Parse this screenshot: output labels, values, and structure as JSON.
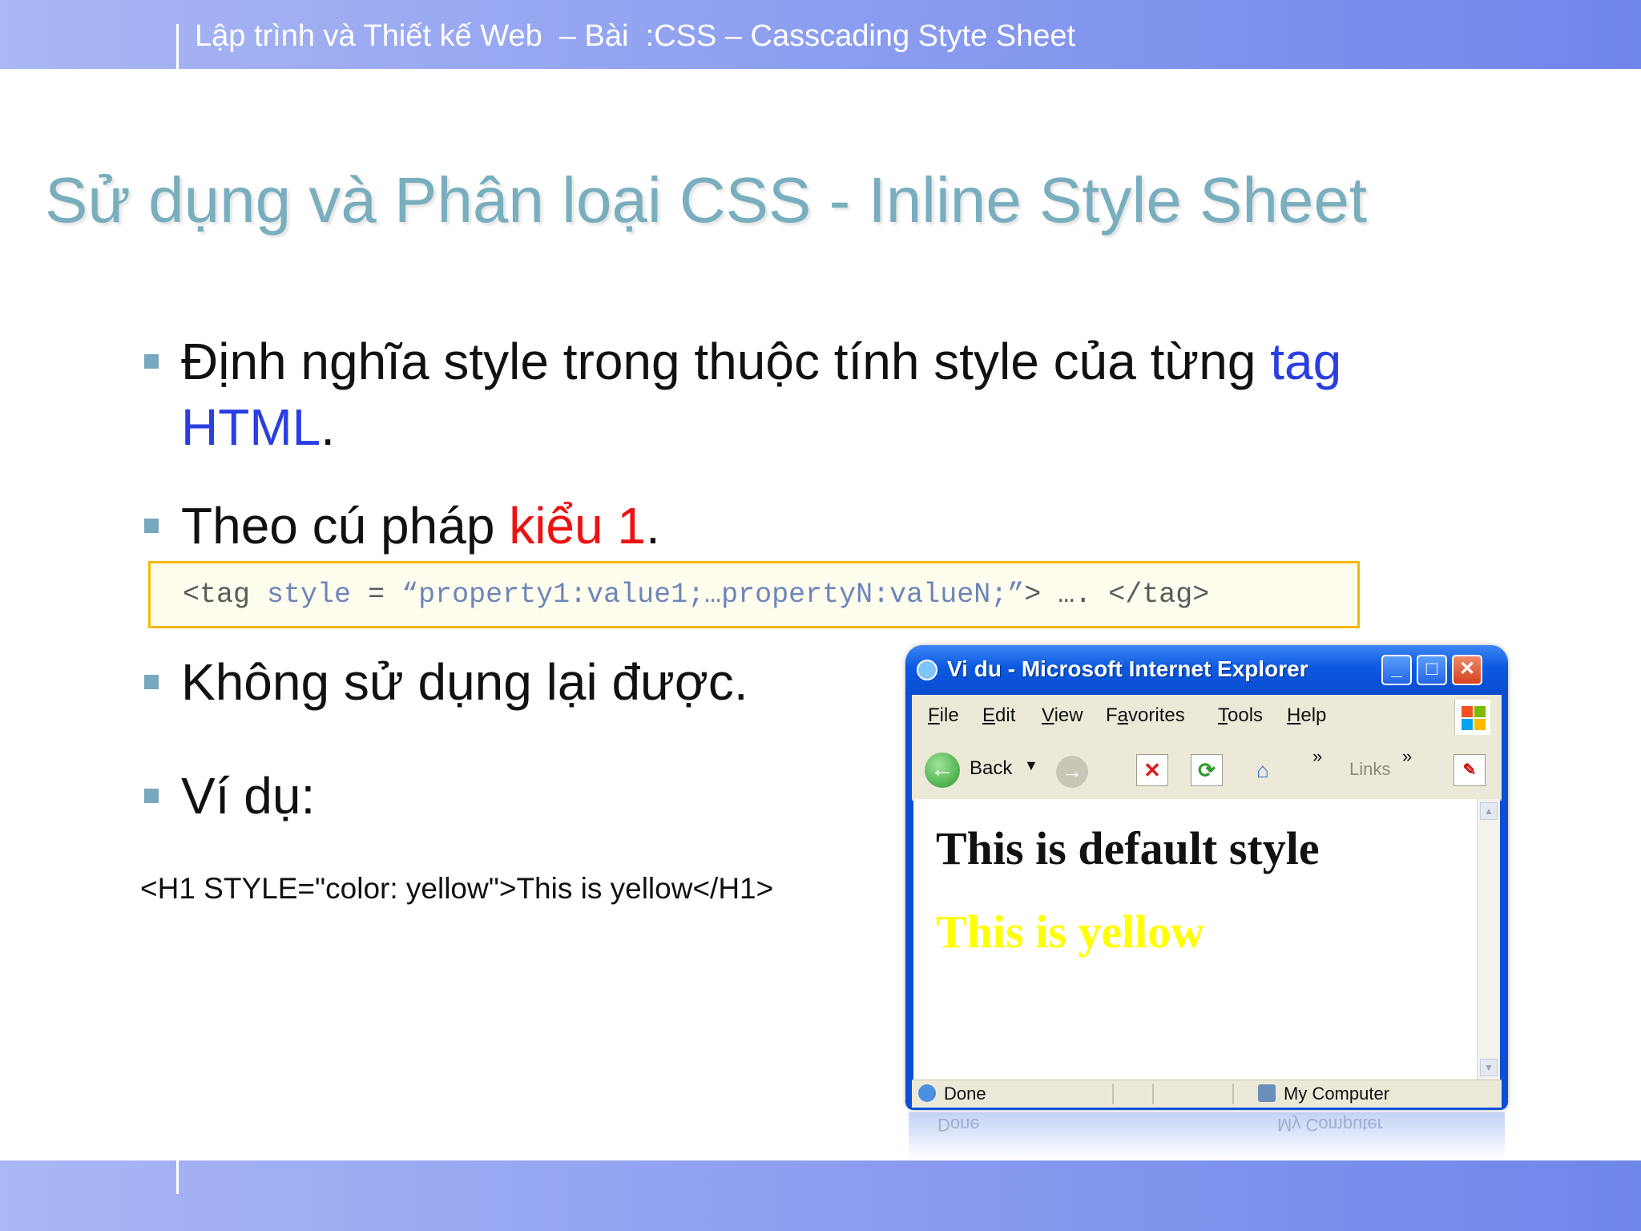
{
  "header": {
    "text": "Lập trình và Thiết kế Web  – Bài  :CSS – Casscading Styte Sheet"
  },
  "slide": {
    "title": "Sử dụng và Phân loại CSS - Inline Style Sheet",
    "bullets": {
      "b1_text": "Định nghĩa style trong thuộc tính style của từng ",
      "b1_tag": "tag",
      "b1_html": "HTML",
      "b1_period": ".",
      "b2_text": "Theo cú pháp ",
      "b2_red": "kiểu 1",
      "b2_period": ".",
      "b3_text": "Không sử dụng lại được.",
      "b4_text": "Ví dụ:"
    },
    "code_syntax": {
      "part1": "<tag ",
      "part2": "style",
      "part3": " = ",
      "part4": "“property1:value1;…propertyN:valueN;”",
      "part5": "> …. </tag>"
    },
    "example_code": "<H1 STYLE=\"color: yellow\">This is yellow</H1>"
  },
  "browser": {
    "title": "Vi du - Microsoft Internet Explorer",
    "window_buttons": {
      "minimize": "_",
      "maximize": "□",
      "close": "✕"
    },
    "menu": [
      "File",
      "Edit",
      "View",
      "Favorites",
      "Tools",
      "Help"
    ],
    "menu_accel": [
      "F",
      "E",
      "V",
      "a",
      "T",
      "H"
    ],
    "toolbar": {
      "back_label": "Back",
      "links_label": "Links",
      "more": "»"
    },
    "content": {
      "line1": "This is default style",
      "line1_color": "#111111",
      "line2": "This is yellow",
      "line2_color": "#ffff00"
    },
    "status": {
      "left": "Done",
      "right": "My Computer"
    },
    "colors": {
      "xp_blue": "#0b4fd8",
      "chrome": "#ece9d8"
    },
    "icons": [
      "ie-icon",
      "back-icon",
      "forward-icon",
      "stop-icon",
      "refresh-icon",
      "home-icon",
      "windows-logo-icon",
      "pdf-icon",
      "computer-icon"
    ]
  },
  "theme_colors": {
    "title": "#79aebe",
    "bar": "#8c9ef0",
    "link_blue": "#2a3ee0",
    "red": "#ee1111",
    "code_border": "#f6b800"
  }
}
